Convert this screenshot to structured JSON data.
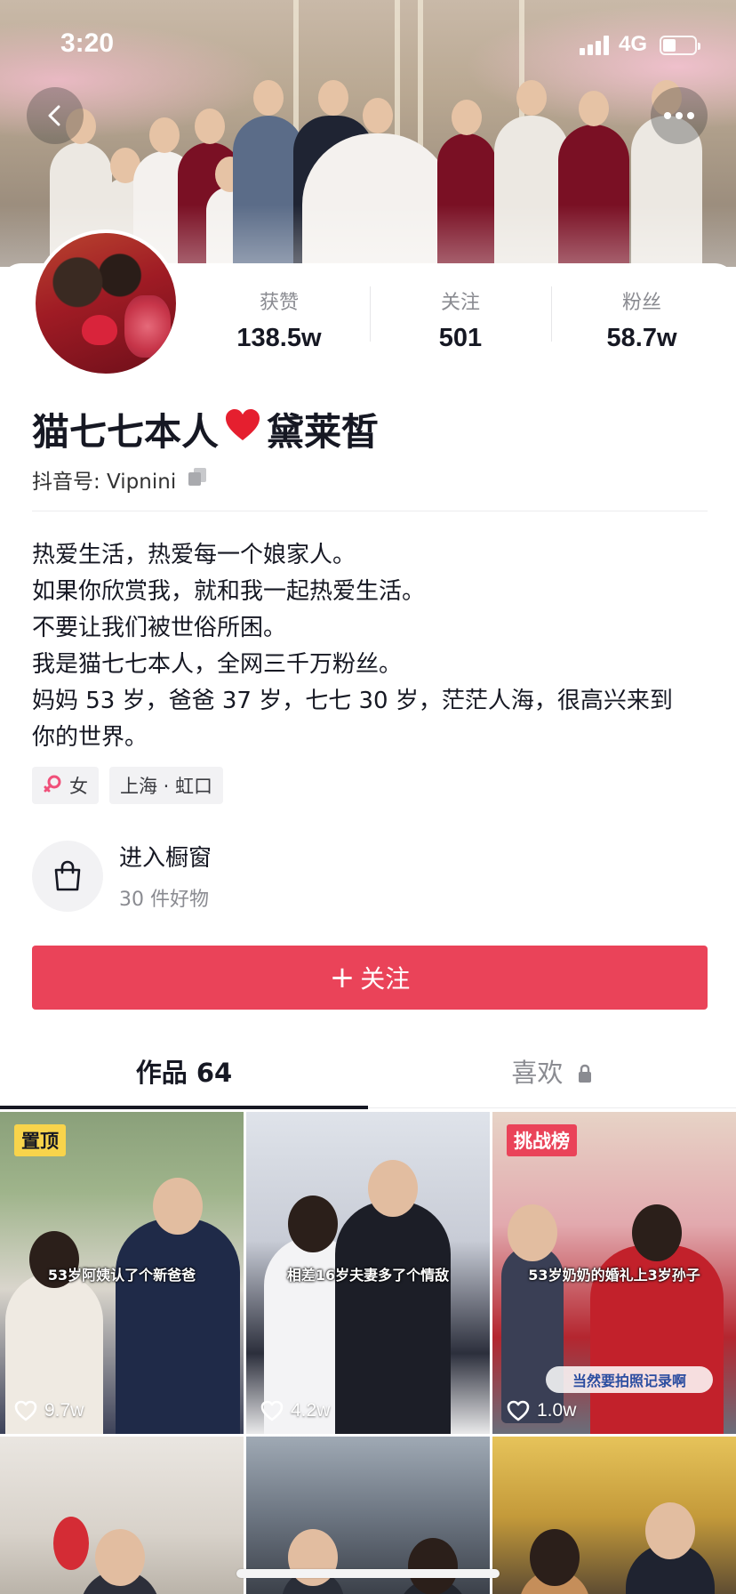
{
  "status_bar": {
    "time": "3:20",
    "network": "4G"
  },
  "profile": {
    "stats": [
      {
        "label": "获赞",
        "value": "138.5w"
      },
      {
        "label": "关注",
        "value": "501"
      },
      {
        "label": "粉丝",
        "value": "58.7w"
      }
    ],
    "name_part1": "猫七七本人",
    "name_emoji": "❤️",
    "name_part2": "黛莱皙",
    "douyin_id": "抖音号: Vipnini",
    "bio": [
      "热爱生活，热爱每一个娘家人。",
      "如果你欣赏我，就和我一起热爱生活。",
      "不要让我们被世俗所困。",
      "我是猫七七本人，全网三千万粉丝。",
      "妈妈 53 岁，爸爸 37 岁，七七 30 岁，茫茫人海，很高兴来到",
      "你的世界。"
    ],
    "tags": {
      "gender": "女",
      "location": "上海 · 虹口"
    },
    "shop": {
      "title": "进入橱窗",
      "subtitle": "30 件好物"
    },
    "follow_label": "关注"
  },
  "tabs": {
    "works": "作品 64",
    "likes": "喜欢"
  },
  "videos": [
    {
      "badge": "置顶",
      "caption": "53岁阿姨认了个新爸爸",
      "likes": "9.7w"
    },
    {
      "badge": "",
      "caption": "相差16岁夫妻多了个情敌",
      "likes": "4.2w"
    },
    {
      "badge": "挑战榜",
      "caption": "53岁奶奶的婚礼上3岁孙子",
      "caption2": "当然要拍照记录啊",
      "likes": "1.0w"
    }
  ],
  "colors": {
    "accent": "#ea4359",
    "pin_badge": "#f8d44b",
    "text_primary": "#161823",
    "text_secondary": "#8a8b91"
  }
}
